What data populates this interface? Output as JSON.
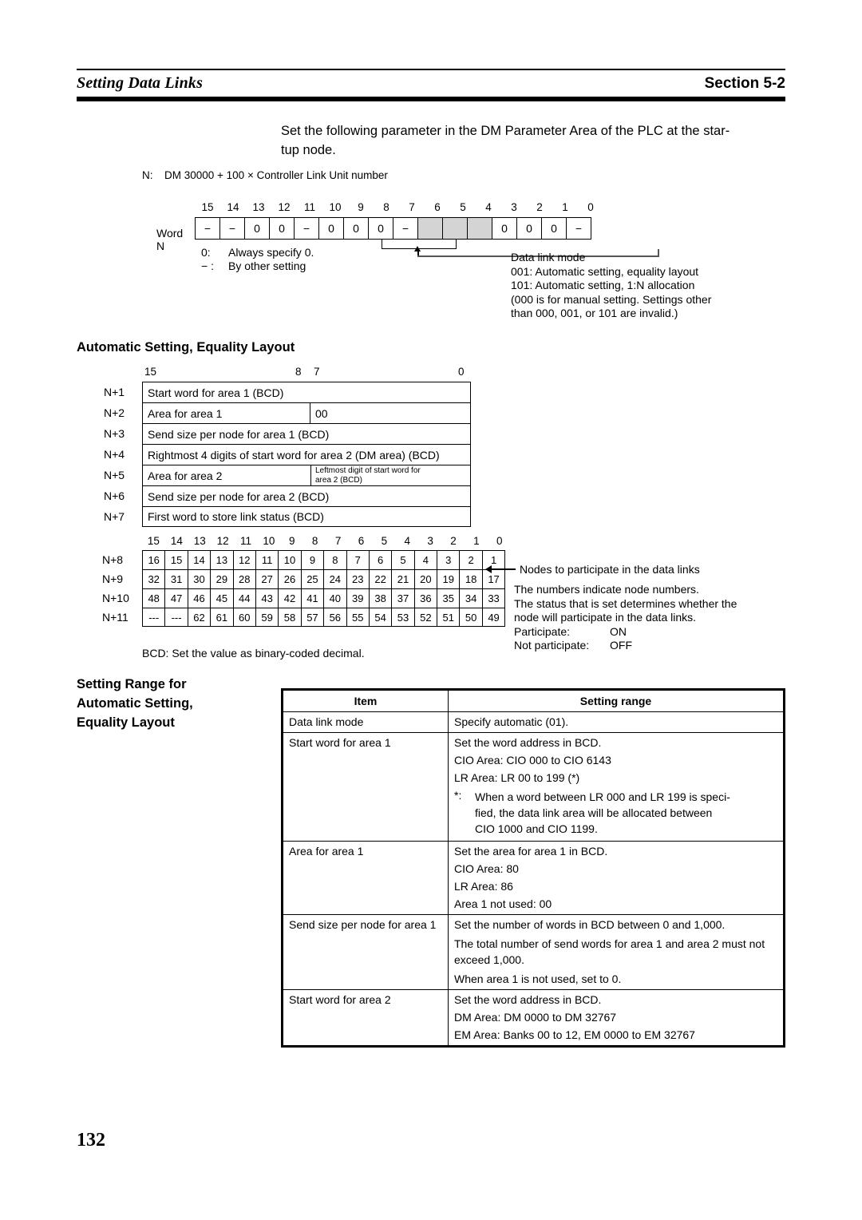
{
  "header": {
    "left_title": "Setting Data Links",
    "right_title": "Section 5-2"
  },
  "intro": {
    "line1": "Set the following parameter in the DM Parameter Area of the PLC at the star-",
    "line2": "tup node."
  },
  "n_definition": {
    "label": "N:",
    "text": "DM 30000 + 100 × Controller Link Unit number"
  },
  "word_n_diagram": {
    "row_label": "Word N",
    "bit_numbers": [
      "15",
      "14",
      "13",
      "12",
      "11",
      "10",
      "9",
      "8",
      "7",
      "6",
      "5",
      "4",
      "3",
      "2",
      "1",
      "0"
    ],
    "bit_values": [
      "−",
      "−",
      "0",
      "0",
      "−",
      "0",
      "0",
      "0",
      "−",
      "",
      "",
      "",
      "0",
      "0",
      "0",
      "−"
    ],
    "shaded_bits": [
      6,
      5,
      4
    ],
    "legend": [
      {
        "key": "0:",
        "text": "Always specify 0."
      },
      {
        "key": "− :",
        "text": "By other setting"
      }
    ],
    "callout": [
      "Data link mode",
      "001: Automatic setting, equality layout",
      "101: Automatic setting, 1:N allocation",
      "(000 is for manual setting. Settings other",
      "than 000, 001, or 101 are invalid.)"
    ]
  },
  "subtitle_automatic": "Automatic Setting, Equality Layout",
  "word_table": {
    "scale": {
      "b15": "15",
      "b8": "8",
      "b7": "7",
      "b0": "0"
    },
    "rows": [
      {
        "index": "N+1",
        "type": "full",
        "text": "Start word for area 1  (BCD)"
      },
      {
        "index": "N+2",
        "type": "split",
        "left": "Area for area 1",
        "right": "00"
      },
      {
        "index": "N+3",
        "type": "full",
        "text": "Send size per node for area 1 (BCD)"
      },
      {
        "index": "N+4",
        "type": "full",
        "text": "Rightmost 4 digits of start word for area 2 (DM area) (BCD)"
      },
      {
        "index": "N+5",
        "type": "split-small",
        "left": "Area for area 2",
        "right_line1": "Leftmost digit of start word for",
        "right_line2": "area 2 (BCD)"
      },
      {
        "index": "N+6",
        "type": "full",
        "text": "Send size per node for area 2 (BCD)"
      },
      {
        "index": "N+7",
        "type": "full",
        "text": "First word to store link status (BCD)"
      }
    ]
  },
  "node_table": {
    "bit_numbers": [
      "15",
      "14",
      "13",
      "12",
      "11",
      "10",
      "9",
      "8",
      "7",
      "6",
      "5",
      "4",
      "3",
      "2",
      "1",
      "0"
    ],
    "rows": [
      {
        "index": "N+8",
        "cells": [
          "16",
          "15",
          "14",
          "13",
          "12",
          "11",
          "10",
          "9",
          "8",
          "7",
          "6",
          "5",
          "4",
          "3",
          "2",
          "1"
        ]
      },
      {
        "index": "N+9",
        "cells": [
          "32",
          "31",
          "30",
          "29",
          "28",
          "27",
          "26",
          "25",
          "24",
          "23",
          "22",
          "21",
          "20",
          "19",
          "18",
          "17"
        ]
      },
      {
        "index": "N+10",
        "cells": [
          "48",
          "47",
          "46",
          "45",
          "44",
          "43",
          "42",
          "41",
          "40",
          "39",
          "38",
          "37",
          "36",
          "35",
          "34",
          "33"
        ]
      },
      {
        "index": "N+11",
        "cells": [
          "---",
          "---",
          "62",
          "61",
          "60",
          "59",
          "58",
          "57",
          "56",
          "55",
          "54",
          "53",
          "52",
          "51",
          "50",
          "49"
        ]
      }
    ],
    "bcd_note": "BCD: Set the value as binary-coded decimal.",
    "callout_title": "Nodes to participate in the data links",
    "callout_body": [
      "The numbers indicate node numbers.",
      "The status that is set determines whether the",
      "node will participate in the data links."
    ],
    "participate_label": "Participate:",
    "participate_value": "ON",
    "not_participate_label": "Not participate:",
    "not_participate_value": "OFF"
  },
  "side_heading": {
    "line1": "Setting Range for",
    "line2": "Automatic Setting,",
    "line3": "Equality Layout"
  },
  "range_table": {
    "headers": {
      "item": "Item",
      "setting": "Setting range"
    },
    "rows": [
      {
        "item": "Data link mode",
        "lines": [
          "Specify automatic (01)."
        ]
      },
      {
        "item": "Start word for area 1",
        "lines": [
          "Set the word address in BCD.",
          "CIO Area: CIO 000 to CIO 6143",
          "LR Area: LR 00 to 199 (*)"
        ],
        "footnote_key": "*:",
        "footnote_lines": [
          "When a word between LR 000 and LR 199 is speci-",
          "fied, the data link area will be allocated between",
          "CIO 1000 and CIO 1199."
        ]
      },
      {
        "item": "Area for area 1",
        "lines": [
          "Set the area for area 1 in BCD.",
          "CIO Area: 80",
          "LR Area: 86",
          "Area 1 not used: 00"
        ]
      },
      {
        "item": "Send size per node for area 1",
        "lines": [
          "Set the number of words in BCD between 0 and 1,000.",
          "The total number of send words for area 1 and area 2 must not exceed 1,000.",
          "When area 1 is not used, set to 0."
        ]
      },
      {
        "item": "Start word for area 2",
        "lines": [
          "Set the word address in BCD.",
          "DM Area: DM 0000 to DM 32767",
          "EM Area: Banks 00 to 12, EM 0000 to EM 32767"
        ]
      }
    ]
  },
  "page_number": "132"
}
